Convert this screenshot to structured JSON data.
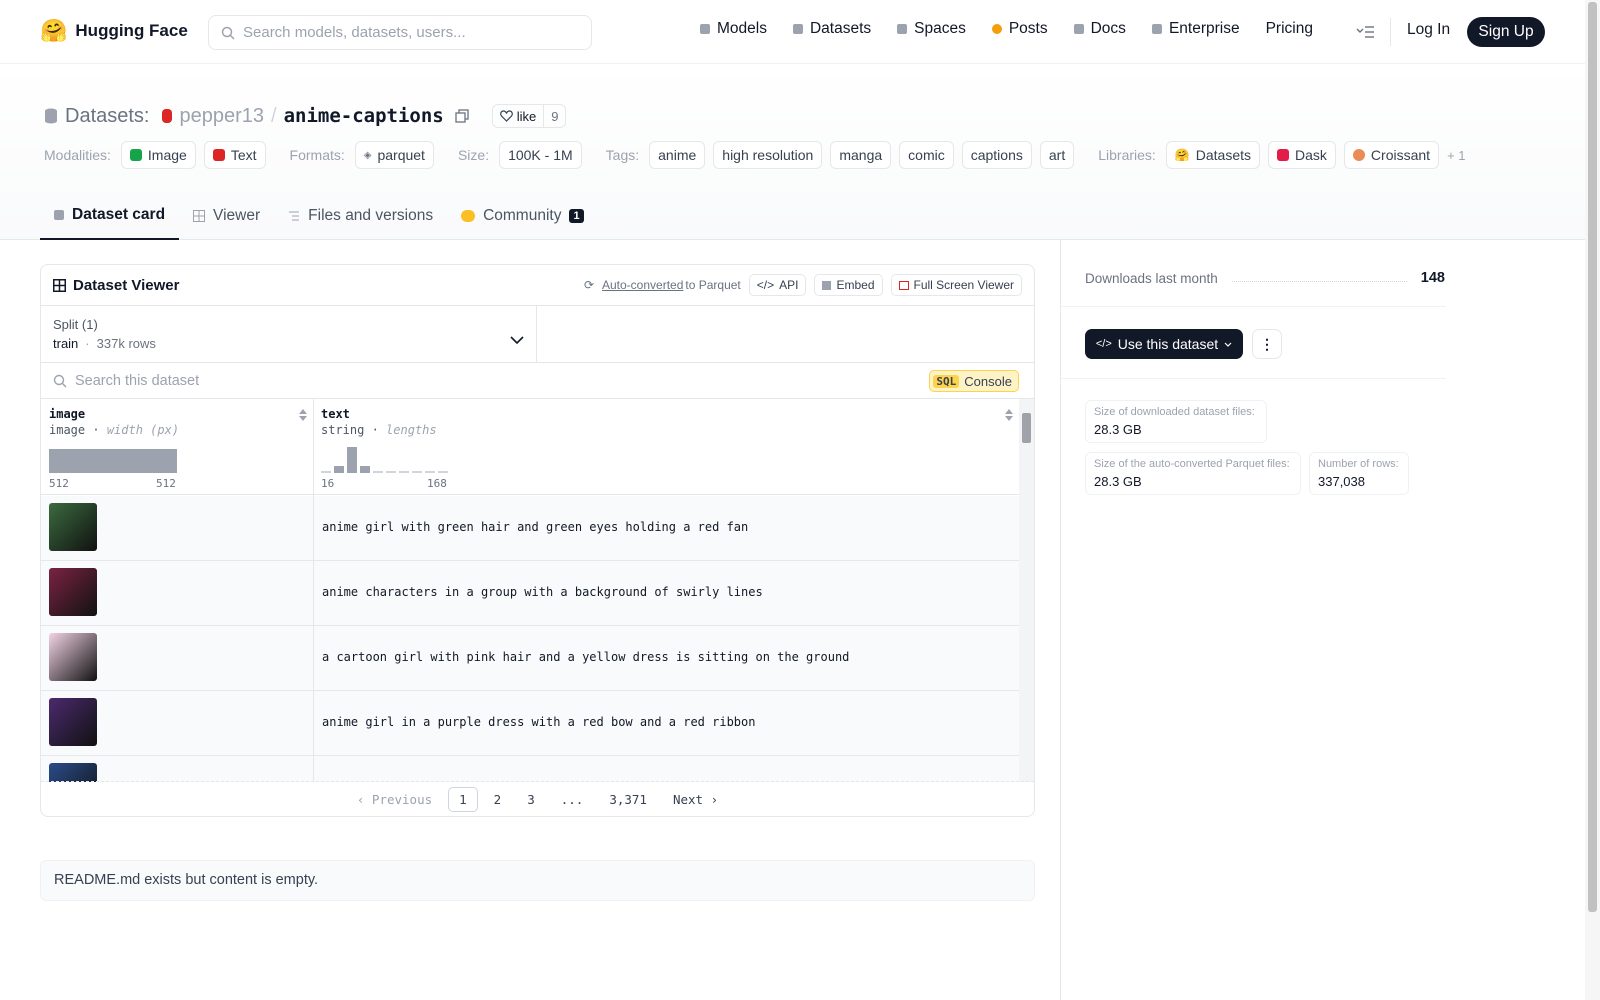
{
  "topbar": {
    "brand": "Hugging Face",
    "search_placeholder": "Search models, datasets, users...",
    "nav": [
      "Models",
      "Datasets",
      "Spaces",
      "Posts",
      "Docs",
      "Enterprise",
      "Pricing"
    ],
    "login": "Log In",
    "signup": "Sign Up"
  },
  "header": {
    "prefix": "Datasets:",
    "owner": "pepper13",
    "name": "anime-captions",
    "like_label": "like",
    "like_count": "9",
    "modalities_label": "Modalities:",
    "modalities": [
      "Image",
      "Text"
    ],
    "formats_label": "Formats:",
    "formats": [
      "parquet"
    ],
    "size_label": "Size:",
    "size": "100K - 1M",
    "tags_label": "Tags:",
    "tags": [
      "anime",
      "high resolution",
      "manga",
      "comic",
      "captions",
      "art"
    ],
    "libraries_label": "Libraries:",
    "libraries": [
      "Datasets",
      "Dask",
      "Croissant"
    ],
    "more": "+ 1"
  },
  "tabs": {
    "card": "Dataset card",
    "viewer": "Viewer",
    "files": "Files and versions",
    "community": "Community",
    "community_count": "1"
  },
  "viewer": {
    "title": "Dataset Viewer",
    "auto_converted": "Auto-converted",
    "to_parquet": "to Parquet",
    "api": "API",
    "embed": "Embed",
    "fullscreen": "Full Screen Viewer",
    "split_label": "Split (1)",
    "split_name": "train",
    "split_rows": "337k rows",
    "search_placeholder": "Search this dataset",
    "sql": "SQL",
    "console": "Console",
    "columns": [
      {
        "name": "image",
        "type": "image",
        "stat": "width (px)",
        "min": "512",
        "max": "512"
      },
      {
        "name": "text",
        "type": "string",
        "stat": "lengths",
        "min": "16",
        "max": "168"
      }
    ],
    "rows": [
      {
        "text": "anime girl with green hair and green eyes holding a red fan",
        "color": "#3a6b3f"
      },
      {
        "text": "anime characters in a group with a background of swirly lines",
        "color": "#7a2342"
      },
      {
        "text": "a cartoon girl with pink hair and a yellow dress is sitting on the ground",
        "color": "#f3d4e6"
      },
      {
        "text": "anime girl in a purple dress with a red bow and a red ribbon",
        "color": "#4b2a6e"
      },
      {
        "text": "",
        "color": "#2a4c8a"
      }
    ],
    "pager": {
      "previous": "Previous",
      "pages": [
        "1",
        "2",
        "3",
        "...",
        "3,371"
      ],
      "next": "Next"
    }
  },
  "readme": "README.md exists but content is empty.",
  "sidebar": {
    "downloads_label": "Downloads last month",
    "downloads": "148",
    "use_dataset": "Use this dataset",
    "stats": [
      {
        "label": "Size of downloaded dataset files:",
        "value": "28.3 GB"
      },
      {
        "label": "Size of the auto-converted Parquet files:",
        "value": "28.3 GB"
      },
      {
        "label": "Number of rows:",
        "value": "337,038"
      }
    ]
  },
  "text_hist": [
    1,
    3,
    12,
    3,
    1,
    1,
    1,
    1,
    1,
    1
  ]
}
